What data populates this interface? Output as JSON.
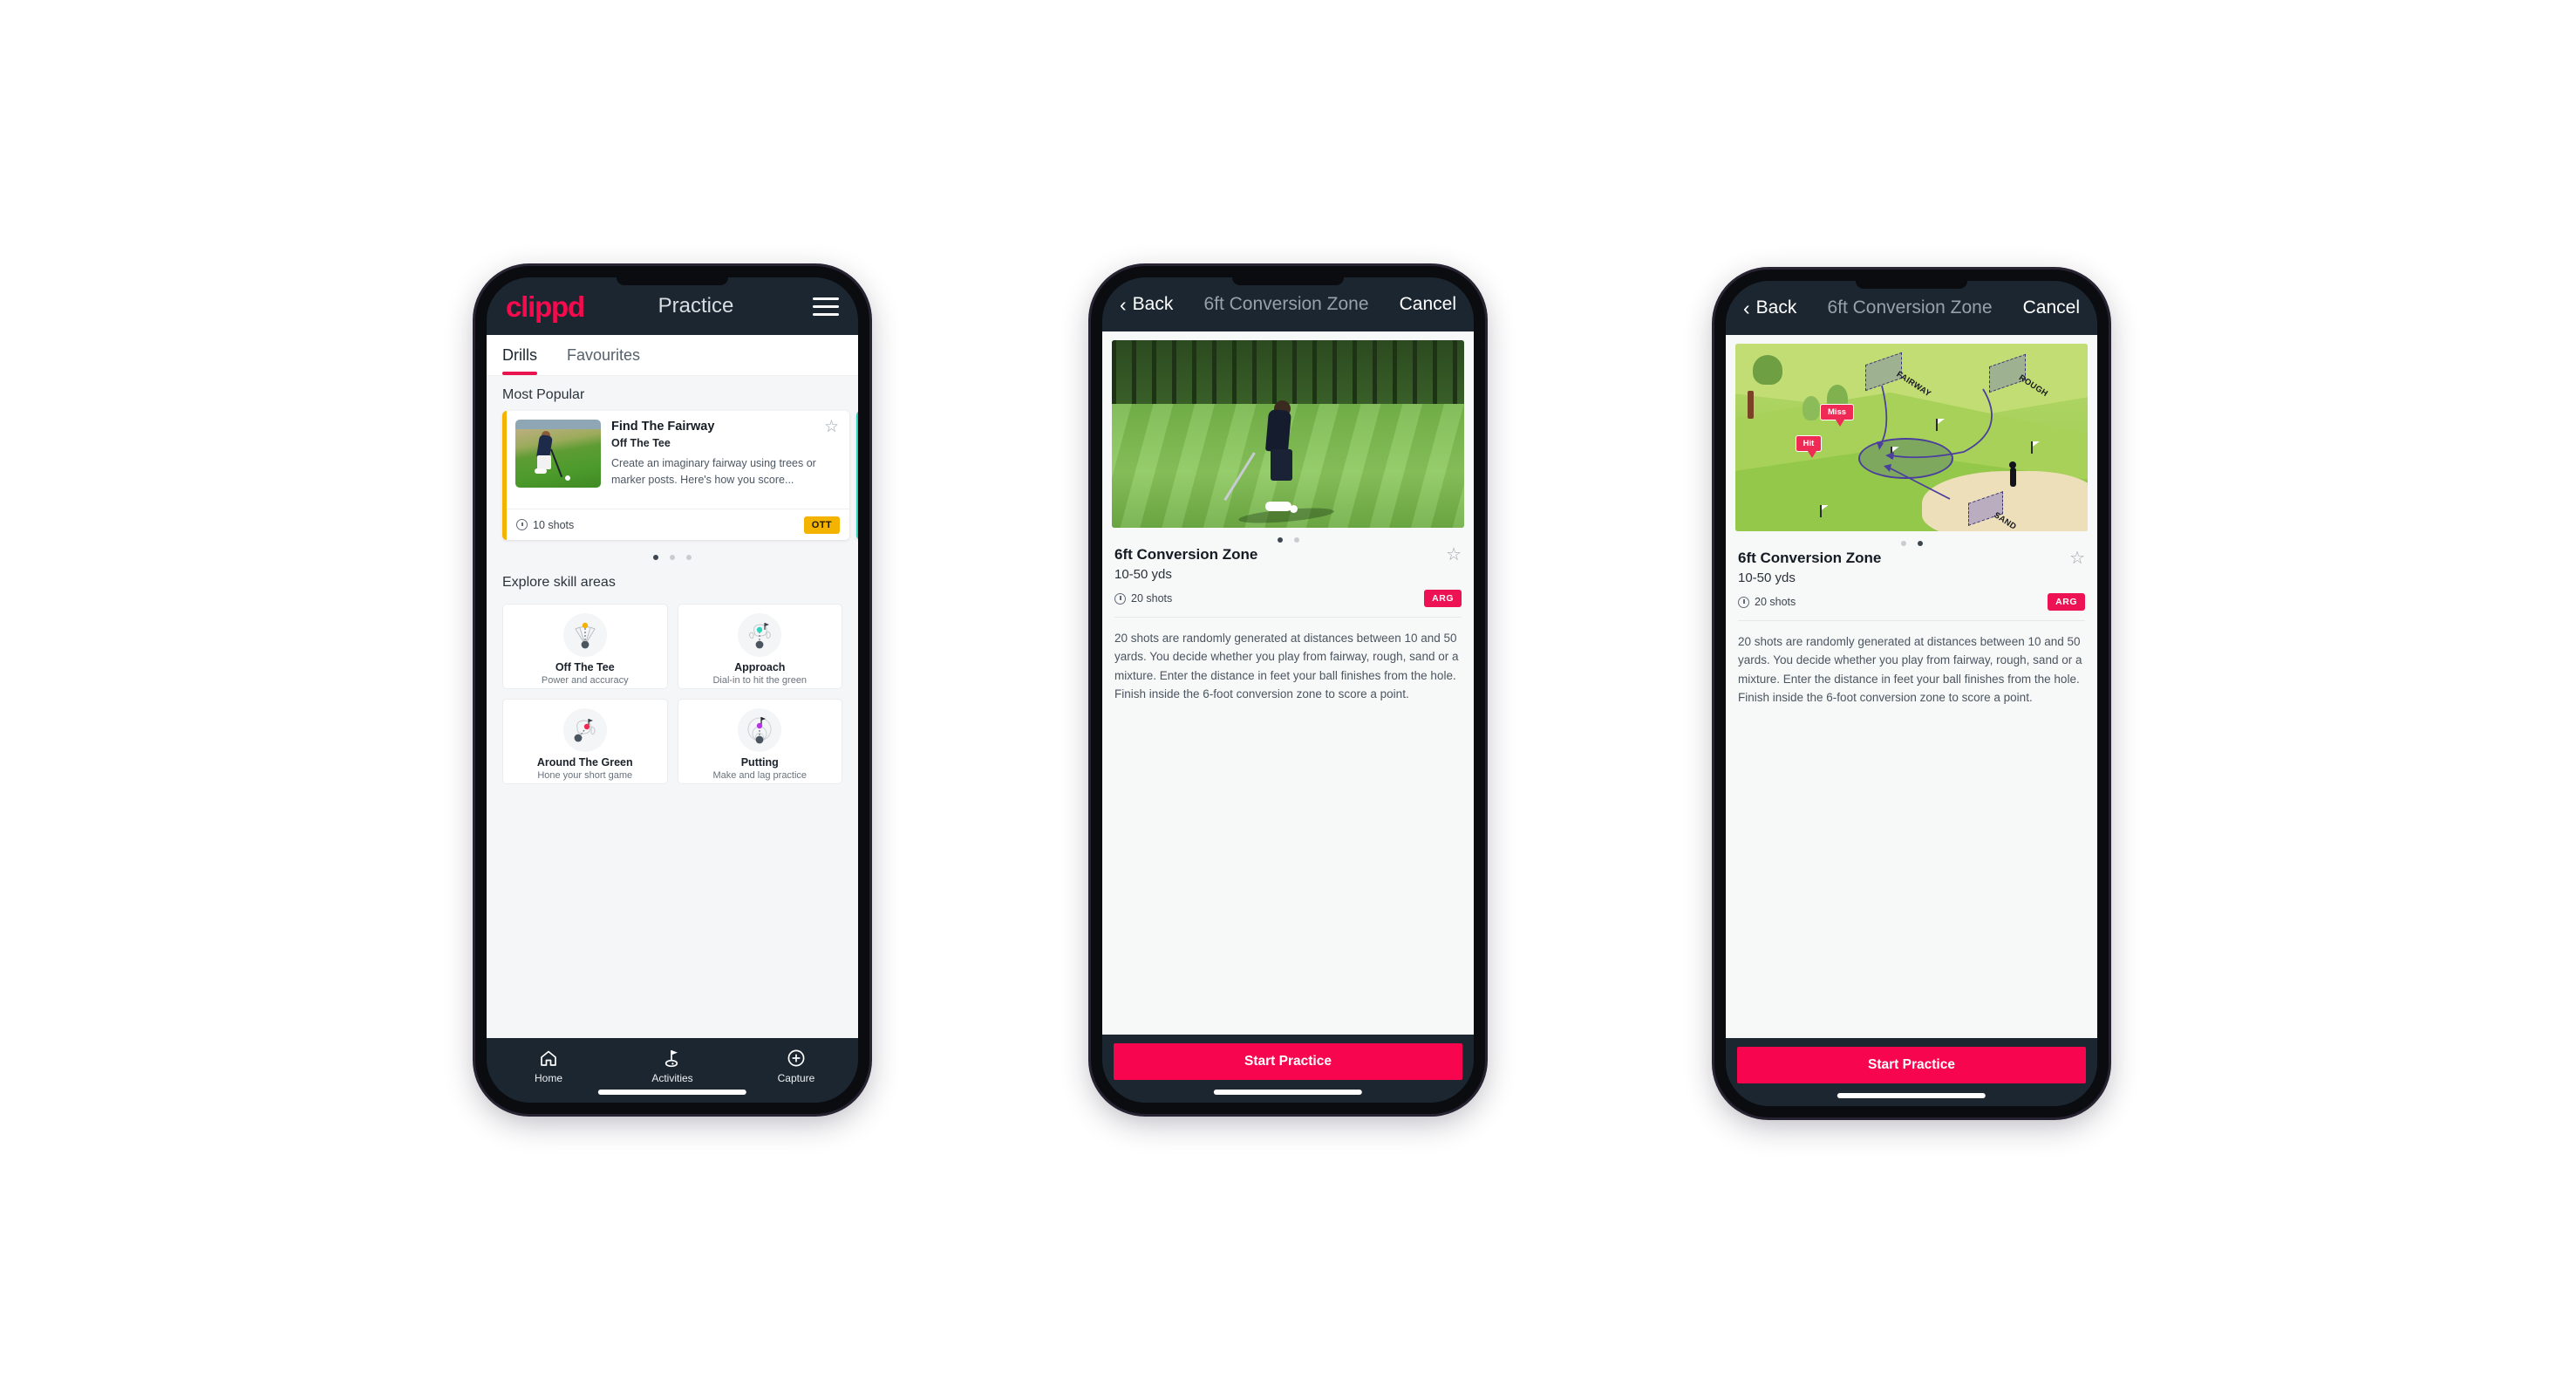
{
  "phone1": {
    "header": {
      "brand": "clippd",
      "title": "Practice",
      "menu_icon": "hamburger-icon"
    },
    "tabs": [
      {
        "label": "Drills",
        "active": true
      },
      {
        "label": "Favourites",
        "active": false
      }
    ],
    "most_popular": {
      "section_title": "Most Popular",
      "card": {
        "name": "Find The Fairway",
        "category": "Off The Tee",
        "description": "Create an imaginary fairway using trees or marker posts. Here's how you score...",
        "shots": "10 shots",
        "badge": "OTT",
        "badge_color": "#f5b301",
        "star_icon": "star-outline-icon",
        "clock_icon": "clock-icon"
      },
      "peek_card_color": "#2fd4bb",
      "dots": [
        true,
        false,
        false
      ]
    },
    "explore": {
      "section_title": "Explore skill areas",
      "cards": [
        {
          "name": "Off The Tee",
          "sub": "Power and accuracy",
          "icon": "tee-fan-icon",
          "accent": "#f5b301"
        },
        {
          "name": "Approach",
          "sub": "Dial-in to hit the green",
          "icon": "approach-green-icon",
          "accent": "#2fd4bb"
        },
        {
          "name": "Around The Green",
          "sub": "Hone your short game",
          "icon": "around-green-icon",
          "accent": "#ef2b55"
        },
        {
          "name": "Putting",
          "sub": "Make and lag practice",
          "icon": "putting-rings-icon",
          "accent": "#b833e8"
        }
      ]
    },
    "bottom_nav": [
      {
        "label": "Home",
        "icon": "home-icon",
        "active": false
      },
      {
        "label": "Activities",
        "icon": "golf-flag-icon",
        "active": true
      },
      {
        "label": "Capture",
        "icon": "plus-circle-icon",
        "active": false
      }
    ]
  },
  "phone2": {
    "header": {
      "back": "Back",
      "title": "6ft Conversion Zone",
      "cancel": "Cancel",
      "back_icon": "chevron-left-icon"
    },
    "hero": {
      "type": "photo",
      "alt": "golfer-chipping-photo"
    },
    "dots": [
      true,
      false
    ],
    "detail": {
      "title": "6ft Conversion Zone",
      "subtitle": "10-50 yds",
      "shots": "20 shots",
      "badge": "ARG",
      "badge_color": "#ec1254",
      "star_icon": "star-outline-icon",
      "clock_icon": "clock-icon",
      "description": "20 shots are randomly generated at distances between 10 and 50 yards. You decide whether you play from fairway, rough, sand or a mixture. Enter the distance in feet your ball finishes from the hole. Finish inside the 6-foot conversion zone to score a point."
    },
    "footer": {
      "start_label": "Start Practice",
      "start_color": "#f8054f"
    }
  },
  "phone3": {
    "header": {
      "back": "Back",
      "title": "6ft Conversion Zone",
      "cancel": "Cancel",
      "back_icon": "chevron-left-icon"
    },
    "hero": {
      "type": "illustration",
      "alt": "isometric-golf-course-illustration",
      "labels": {
        "fairway": "FAIRWAY",
        "rough": "ROUGH",
        "sand": "SAND"
      },
      "tags": {
        "miss": "Miss",
        "hit": "Hit"
      }
    },
    "dots": [
      false,
      true
    ],
    "detail": {
      "title": "6ft Conversion Zone",
      "subtitle": "10-50 yds",
      "shots": "20 shots",
      "badge": "ARG",
      "badge_color": "#ec1254",
      "star_icon": "star-outline-icon",
      "clock_icon": "clock-icon",
      "description": "20 shots are randomly generated at distances between 10 and 50 yards. You decide whether you play from fairway, rough, sand or a mixture. Enter the distance in feet your ball finishes from the hole. Finish inside the 6-foot conversion zone to score a point."
    },
    "footer": {
      "start_label": "Start Practice",
      "start_color": "#f8054f"
    }
  }
}
